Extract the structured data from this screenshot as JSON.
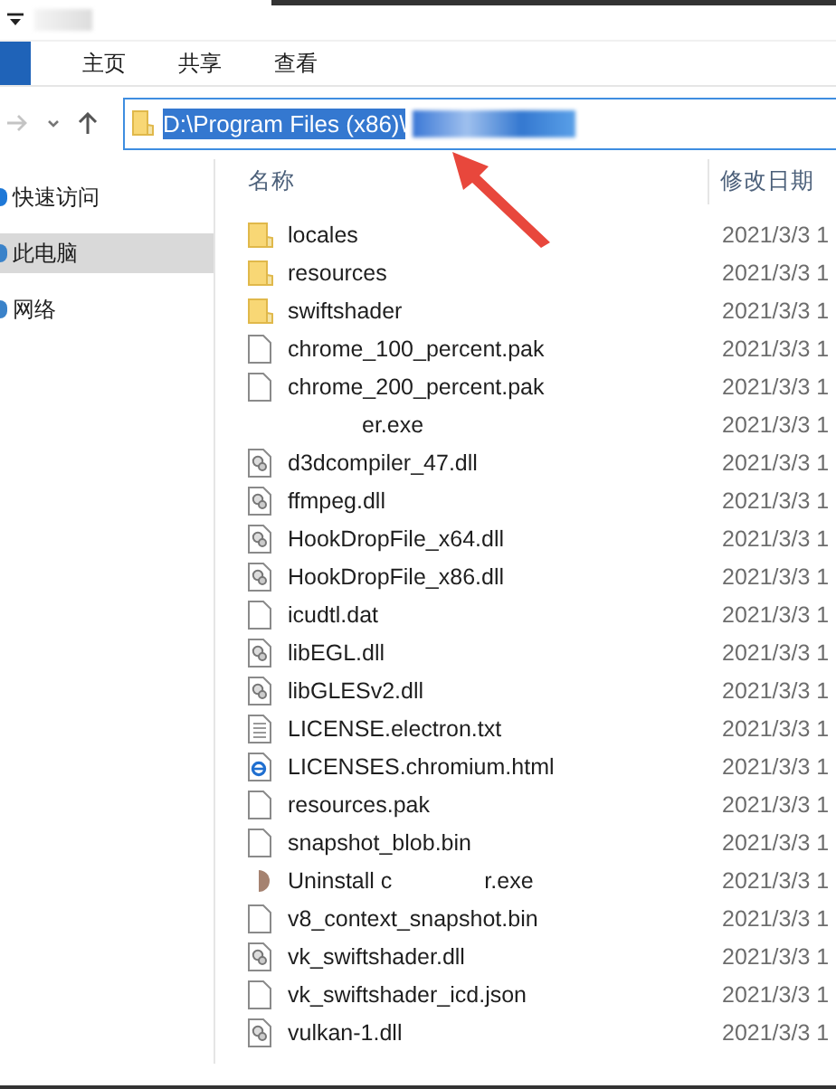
{
  "ribbon_tabs": [
    {
      "label": "主页",
      "selected": false
    },
    {
      "label": "共享",
      "selected": false
    },
    {
      "label": "查看",
      "selected": false
    }
  ],
  "address": {
    "path": "D:\\Program Files (x86)\\",
    "selected": true
  },
  "sidebar": {
    "items": [
      {
        "label": "快速访问",
        "kind": "star",
        "selected": false
      },
      {
        "label": "此电脑",
        "kind": "pc",
        "selected": true
      },
      {
        "label": "网络",
        "kind": "net",
        "selected": false
      }
    ]
  },
  "columns": [
    "名称",
    "修改日期"
  ],
  "files": [
    {
      "kind": "folder",
      "name": "locales",
      "date": "2021/3/3 1"
    },
    {
      "kind": "folder",
      "name": "resources",
      "date": "2021/3/3 1"
    },
    {
      "kind": "folder",
      "name": "swiftshader",
      "date": "2021/3/3 1"
    },
    {
      "kind": "file",
      "name": "chrome_100_percent.pak",
      "date": "2021/3/3 1"
    },
    {
      "kind": "file",
      "name": "chrome_200_percent.pak",
      "date": "2021/3/3 1"
    },
    {
      "kind": "hidden",
      "name": "er.exe",
      "date": "2021/3/3 1"
    },
    {
      "kind": "dll",
      "name": "d3dcompiler_47.dll",
      "date": "2021/3/3 1"
    },
    {
      "kind": "dll",
      "name": "ffmpeg.dll",
      "date": "2021/3/3 1"
    },
    {
      "kind": "dll",
      "name": "HookDropFile_x64.dll",
      "date": "2021/3/3 1"
    },
    {
      "kind": "dll",
      "name": "HookDropFile_x86.dll",
      "date": "2021/3/3 1"
    },
    {
      "kind": "file",
      "name": "icudtl.dat",
      "date": "2021/3/3 1"
    },
    {
      "kind": "dll",
      "name": "libEGL.dll",
      "date": "2021/3/3 1"
    },
    {
      "kind": "dll",
      "name": "libGLESv2.dll",
      "date": "2021/3/3 1"
    },
    {
      "kind": "text",
      "name": "LICENSE.electron.txt",
      "date": "2021/3/3 1"
    },
    {
      "kind": "html",
      "name": "LICENSES.chromium.html",
      "date": "2021/3/3 1"
    },
    {
      "kind": "file",
      "name": "resources.pak",
      "date": "2021/3/3 1"
    },
    {
      "kind": "file",
      "name": "snapshot_blob.bin",
      "date": "2021/3/3 1"
    },
    {
      "kind": "exe",
      "name": "Uninstall c",
      "suffix": "r.exe",
      "date": "2021/3/3 1"
    },
    {
      "kind": "file",
      "name": "v8_context_snapshot.bin",
      "date": "2021/3/3 1"
    },
    {
      "kind": "dll",
      "name": "vk_swiftshader.dll",
      "date": "2021/3/3 1"
    },
    {
      "kind": "file",
      "name": "vk_swiftshader_icd.json",
      "date": "2021/3/3 1"
    },
    {
      "kind": "dll",
      "name": "vulkan-1.dll",
      "date": "2021/3/3 1"
    }
  ]
}
